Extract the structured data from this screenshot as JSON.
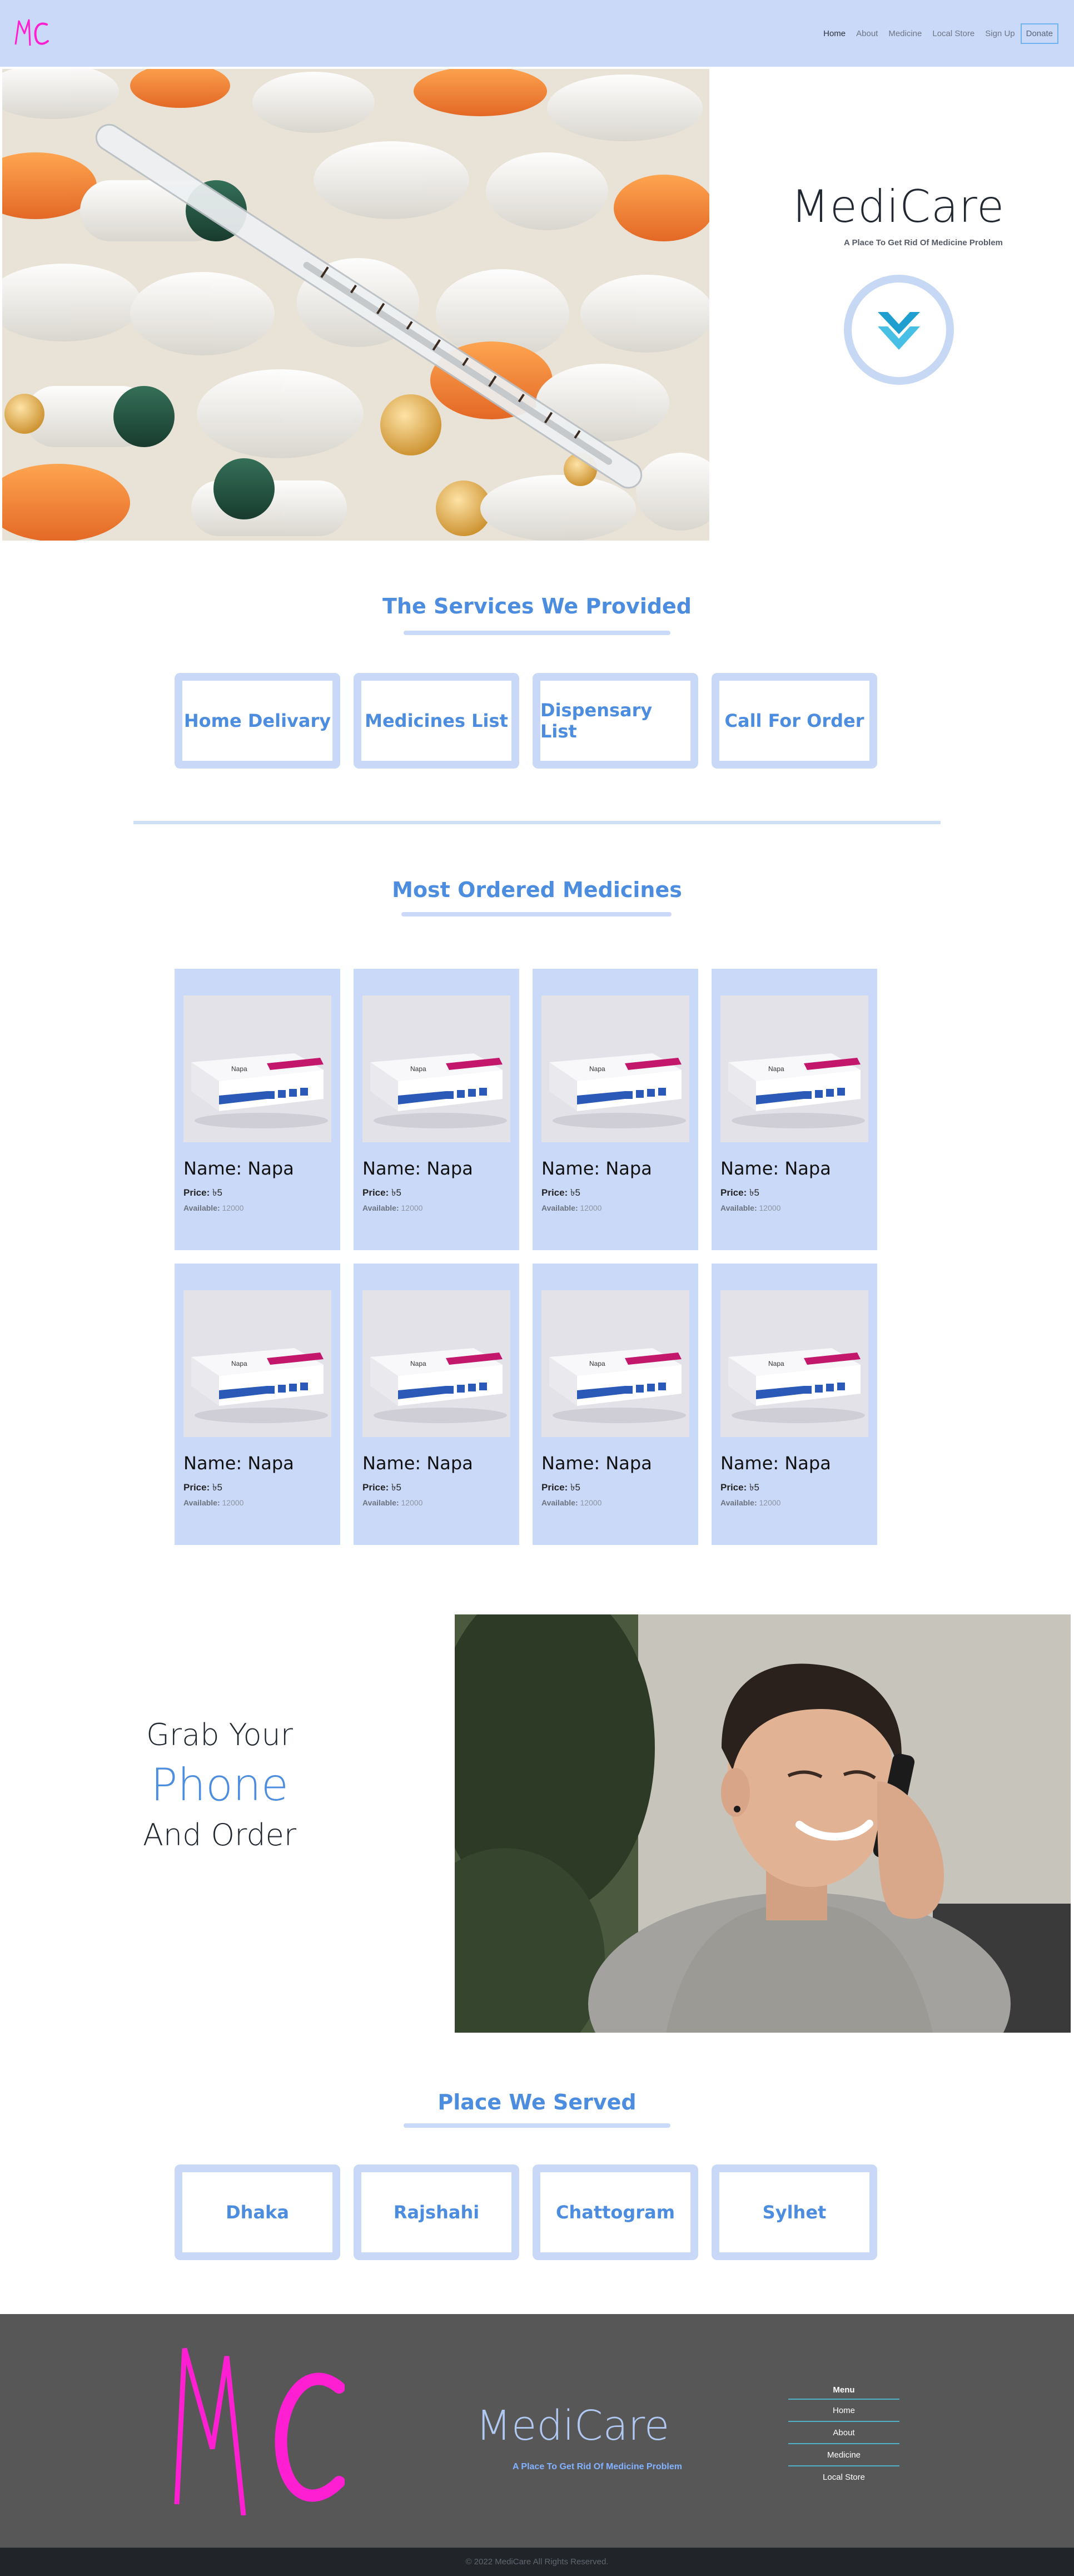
{
  "navbar": {
    "logo_text": "MC",
    "links": [
      {
        "label": "Home"
      },
      {
        "label": "About"
      },
      {
        "label": "Medicine"
      },
      {
        "label": "Local Store"
      },
      {
        "label": "Sign Up"
      }
    ],
    "donate_label": "Donate"
  },
  "hero": {
    "title": "MediCare",
    "subtitle": "A Place To Get Rid Of Medicine Problem",
    "badge_icon": "double-chevron-down-icon"
  },
  "services": {
    "heading": "The Services We Provided",
    "items": [
      {
        "label": "Home Delivary"
      },
      {
        "label": "Medicines List"
      },
      {
        "label": "Dispensary List"
      },
      {
        "label": "Call For Order"
      }
    ]
  },
  "medicines": {
    "heading": "Most Ordered Medicines",
    "price_label": "Price:",
    "available_label": "Available:",
    "items": [
      {
        "name": "Name: Napa",
        "price": "৳5",
        "available": "12000"
      },
      {
        "name": "Name: Napa",
        "price": "৳5",
        "available": "12000"
      },
      {
        "name": "Name: Napa",
        "price": "৳5",
        "available": "12000"
      },
      {
        "name": "Name: Napa",
        "price": "৳5",
        "available": "12000"
      },
      {
        "name": "Name: Napa",
        "price": "৳5",
        "available": "12000"
      },
      {
        "name": "Name: Napa",
        "price": "৳5",
        "available": "12000"
      },
      {
        "name": "Name: Napa",
        "price": "৳5",
        "available": "12000"
      },
      {
        "name": "Name: Napa",
        "price": "৳5",
        "available": "12000"
      }
    ],
    "box_label": "Napa"
  },
  "phone_section": {
    "line1": "Grab Your",
    "line2": "Phone",
    "line3": "And Order"
  },
  "places": {
    "heading": "Place We Served",
    "items": [
      {
        "label": "Dhaka"
      },
      {
        "label": "Rajshahi"
      },
      {
        "label": "Chattogram"
      },
      {
        "label": "Sylhet"
      }
    ]
  },
  "footer": {
    "logo_text": "MC",
    "brand": "MediCare",
    "subtitle": "A Place To Get Rid Of Medicine Problem",
    "menu_title": "Menu",
    "menu_items": [
      {
        "label": "Home"
      },
      {
        "label": "About"
      },
      {
        "label": "Medicine"
      },
      {
        "label": "Local Store"
      }
    ],
    "copyright": "© 2022 MediCare All Rights Reserved."
  },
  "colors": {
    "navbar_bg": "#cad9f7",
    "accent_blue": "#4d8de0",
    "logo_magenta": "#ff1fd2",
    "footer_bg": "#575757",
    "copyright_bg": "#212529"
  }
}
